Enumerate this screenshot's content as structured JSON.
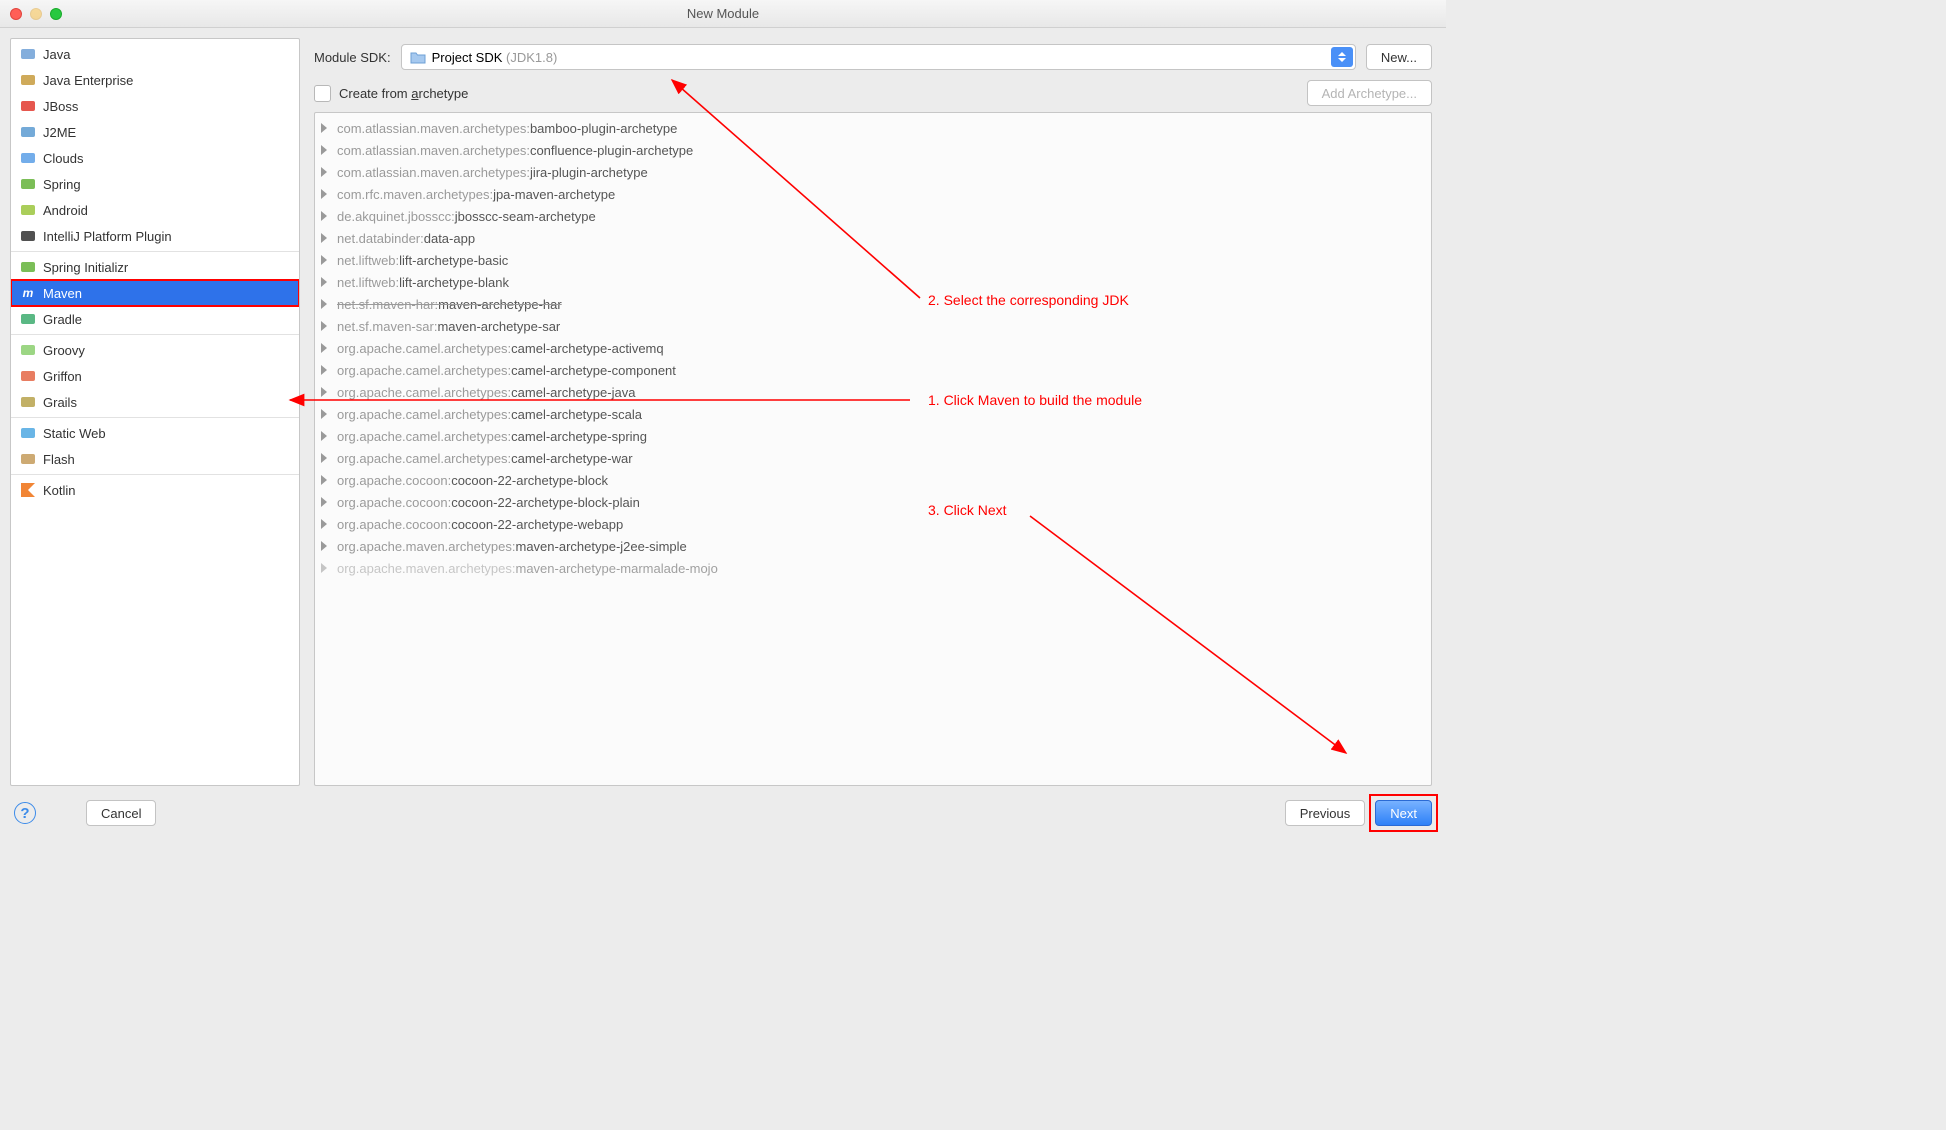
{
  "window": {
    "title": "New Module"
  },
  "sidebar": {
    "groups": [
      {
        "items": [
          {
            "key": "java",
            "label": "Java",
            "icon_color": "#6ea0d6"
          },
          {
            "key": "java-enterprise",
            "label": "Java Enterprise",
            "icon_color": "#c79b3d"
          },
          {
            "key": "jboss",
            "label": "JBoss",
            "icon_color": "#e23a2f"
          },
          {
            "key": "j2me",
            "label": "J2ME",
            "icon_color": "#5c9bd1"
          },
          {
            "key": "clouds",
            "label": "Clouds",
            "icon_color": "#5a9fe6"
          },
          {
            "key": "spring",
            "label": "Spring",
            "icon_color": "#64b33a"
          },
          {
            "key": "android",
            "label": "Android",
            "icon_color": "#9bc53d"
          },
          {
            "key": "intellij-platform-plugin",
            "label": "IntelliJ Platform Plugin",
            "icon_color": "#333333"
          }
        ]
      },
      {
        "items": [
          {
            "key": "spring-initializr",
            "label": "Spring Initializr",
            "icon_color": "#64b33a"
          },
          {
            "key": "maven",
            "label": "Maven",
            "icon_color": "#3385e8",
            "selected": true,
            "highlight": true
          },
          {
            "key": "gradle",
            "label": "Gradle",
            "icon_color": "#3dac6e"
          }
        ]
      },
      {
        "items": [
          {
            "key": "groovy",
            "label": "Groovy",
            "icon_color": "#8bcf6f"
          },
          {
            "key": "griffon",
            "label": "Griffon",
            "icon_color": "#e46645"
          },
          {
            "key": "grails",
            "label": "Grails",
            "icon_color": "#b7a24b"
          }
        ]
      },
      {
        "items": [
          {
            "key": "static-web",
            "label": "Static Web",
            "icon_color": "#4fa8e2"
          },
          {
            "key": "flash",
            "label": "Flash",
            "icon_color": "#c49b5b"
          }
        ]
      },
      {
        "items": [
          {
            "key": "kotlin",
            "label": "Kotlin",
            "icon_color": "#f18535"
          }
        ]
      }
    ]
  },
  "sdk": {
    "label": "Module SDK:",
    "value_main": "Project SDK ",
    "value_grey": "(JDK1.8)",
    "new_button": "New..."
  },
  "archetype_section": {
    "checkbox_label_pre": "Create from ",
    "checkbox_label_underline": "a",
    "checkbox_label_post": "rchetype",
    "add_button": "Add Archetype..."
  },
  "archetypes": [
    {
      "group": "com.atlassian.maven.archetypes:",
      "name": "bamboo-plugin-archetype"
    },
    {
      "group": "com.atlassian.maven.archetypes:",
      "name": "confluence-plugin-archetype"
    },
    {
      "group": "com.atlassian.maven.archetypes:",
      "name": "jira-plugin-archetype"
    },
    {
      "group": "com.rfc.maven.archetypes:",
      "name": "jpa-maven-archetype"
    },
    {
      "group": "de.akquinet.jbosscc:",
      "name": "jbosscc-seam-archetype"
    },
    {
      "group": "net.databinder:",
      "name": "data-app"
    },
    {
      "group": "net.liftweb:",
      "name": "lift-archetype-basic"
    },
    {
      "group": "net.liftweb:",
      "name": "lift-archetype-blank"
    },
    {
      "group": "net.sf.maven-har:",
      "name": "maven-archetype-har",
      "struck": true
    },
    {
      "group": "net.sf.maven-sar:",
      "name": "maven-archetype-sar"
    },
    {
      "group": "org.apache.camel.archetypes:",
      "name": "camel-archetype-activemq"
    },
    {
      "group": "org.apache.camel.archetypes:",
      "name": "camel-archetype-component"
    },
    {
      "group": "org.apache.camel.archetypes:",
      "name": "camel-archetype-java"
    },
    {
      "group": "org.apache.camel.archetypes:",
      "name": "camel-archetype-scala"
    },
    {
      "group": "org.apache.camel.archetypes:",
      "name": "camel-archetype-spring"
    },
    {
      "group": "org.apache.camel.archetypes:",
      "name": "camel-archetype-war"
    },
    {
      "group": "org.apache.cocoon:",
      "name": "cocoon-22-archetype-block"
    },
    {
      "group": "org.apache.cocoon:",
      "name": "cocoon-22-archetype-block-plain"
    },
    {
      "group": "org.apache.cocoon:",
      "name": "cocoon-22-archetype-webapp"
    },
    {
      "group": "org.apache.maven.archetypes:",
      "name": "maven-archetype-j2ee-simple"
    },
    {
      "group": "org.apache.maven.archetypes:",
      "name": "maven-archetype-marmalade-mojo",
      "faded": true
    }
  ],
  "footer": {
    "cancel": "Cancel",
    "previous": "Previous",
    "next": "Next"
  },
  "annotations": {
    "a1": "1. Click Maven to build the module",
    "a2": "2. Select the corresponding JDK",
    "a3": "3. Click Next"
  }
}
